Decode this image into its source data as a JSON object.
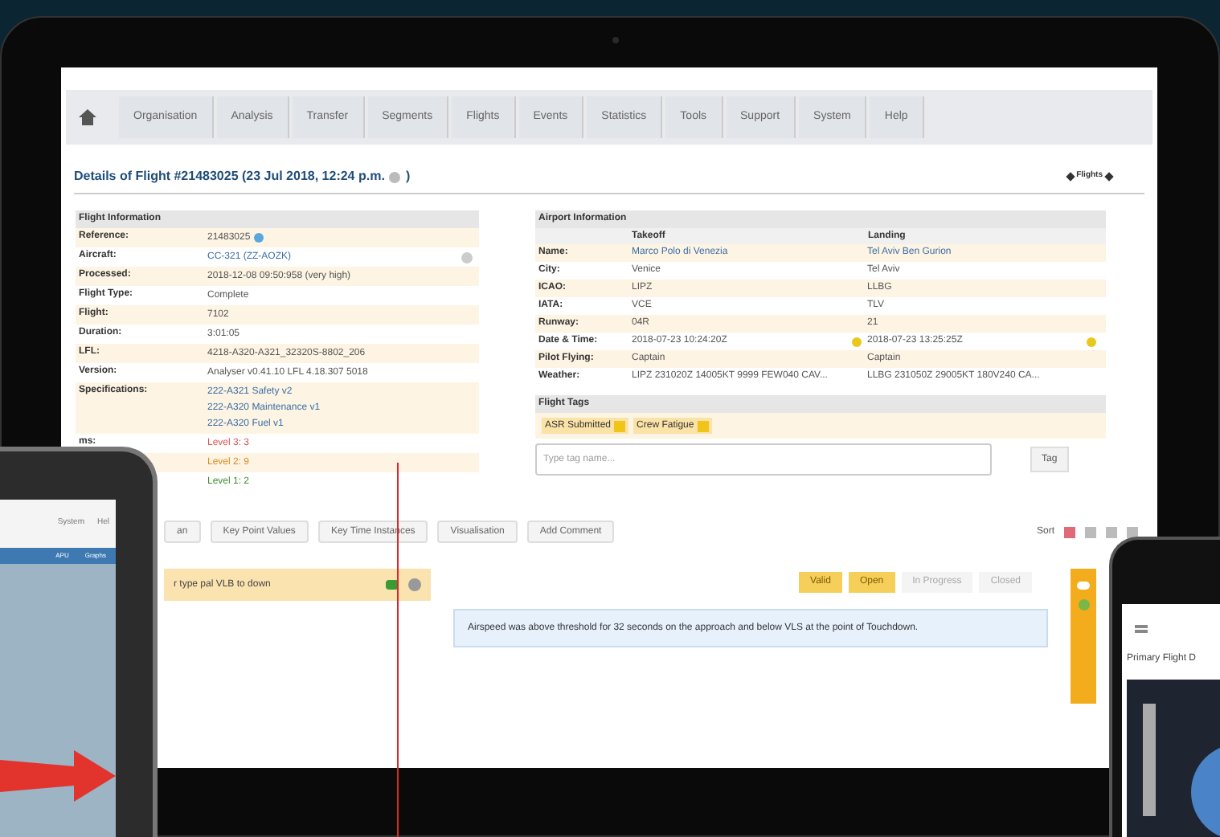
{
  "nav": {
    "tabs": [
      "Organisation",
      "Analysis",
      "Transfer",
      "Segments",
      "Flights",
      "Events",
      "Statistics",
      "Tools",
      "Support",
      "System",
      "Help"
    ]
  },
  "page_title": "Details of Flight #21483025 (23 Jul 2018, 12:24 p.m.",
  "page_title_end": ")",
  "flights_link": "Flights",
  "flight_info": {
    "title": "Flight Information",
    "rows": [
      {
        "label": "Reference:",
        "values": [
          {
            "kind": "plain",
            "text": "21483025"
          }
        ],
        "info": true
      },
      {
        "label": "Aircraft:",
        "values": [
          {
            "kind": "link",
            "text": "CC-321 (ZZ-AOZK)"
          }
        ],
        "action": true
      },
      {
        "label": "Processed:",
        "values": [
          {
            "kind": "plain",
            "text": "2018-12-08 09:50:958 (very high)"
          }
        ]
      },
      {
        "label": "Flight Type:",
        "values": [
          {
            "kind": "plain",
            "text": "Complete"
          }
        ]
      },
      {
        "label": "Flight:",
        "values": [
          {
            "kind": "plain",
            "text": "7102"
          }
        ]
      },
      {
        "label": "Duration:",
        "values": [
          {
            "kind": "plain",
            "text": "3:01:05"
          }
        ]
      },
      {
        "label": "LFL:",
        "values": [
          {
            "kind": "plain",
            "text": "4218-A320-A321_32320S-8802_206"
          }
        ]
      },
      {
        "label": "Version:",
        "values": [
          {
            "kind": "plain",
            "text": "Analyser v0.41.10 LFL 4.18.307 5018"
          }
        ]
      },
      {
        "label": "Specifications:",
        "values": [
          {
            "kind": "link",
            "text": "222-A321 Safety v2"
          },
          {
            "kind": "link",
            "text": "222-A320 Maintenance v1"
          },
          {
            "kind": "link",
            "text": "222-A320 Fuel v1"
          }
        ]
      },
      {
        "label": "ms:",
        "values": [
          {
            "kind": "level",
            "text": "Level 3: 3",
            "color": "#d9534f"
          }
        ]
      },
      {
        "values": [
          {
            "kind": "level",
            "text": "Level 2: 9",
            "color": "#e08a1e"
          }
        ]
      },
      {
        "values": [
          {
            "kind": "level",
            "text": "Level 1: 2",
            "color": "#3c8d2f"
          }
        ]
      }
    ]
  },
  "airport_info": {
    "title": "Airport Information",
    "columns": [
      "Takeoff",
      "Landing"
    ],
    "rows": [
      {
        "label": "Name:",
        "values": [
          "Marco Polo di Venezia",
          "Tel Aviv Ben Gurion"
        ],
        "kind": "link"
      },
      {
        "label": "City:",
        "values": [
          "Venice",
          "Tel Aviv"
        ],
        "kind": "plain"
      },
      {
        "label": "ICAO:",
        "values": [
          "LIPZ",
          "LLBG"
        ],
        "kind": "plain"
      },
      {
        "label": "IATA:",
        "values": [
          "VCE",
          "TLV"
        ],
        "kind": "plain"
      },
      {
        "label": "Runway:",
        "values": [
          "04R",
          "21"
        ],
        "kind": "plain"
      },
      {
        "label": "Date & Time:",
        "values": [
          "2018-07-23 10:24:20Z",
          "2018-07-23 13:25:25Z"
        ],
        "kind": "time"
      },
      {
        "label": "Pilot Flying:",
        "values": [
          "Captain",
          "Captain"
        ],
        "kind": "plain"
      },
      {
        "label": "Weather:",
        "values": [
          "LIPZ 231020Z 14005KT 9999 FEW040 CAV...",
          "LLBG 231050Z 29005KT 180V240 CA..."
        ],
        "kind": "plain"
      }
    ]
  },
  "flight_tags": {
    "title": "Flight Tags",
    "tags": [
      "ASR Submitted",
      "Crew Fatigue"
    ],
    "placeholder": "Type tag name...",
    "button": "Tag"
  },
  "toolbar": {
    "buttons": [
      "an",
      "Key Point Values",
      "Key Time Instances",
      "Visualisation",
      "Add Comment"
    ],
    "sort_label": "Sort"
  },
  "event": {
    "text": "r type pal VLB to down",
    "statuses": [
      {
        "label": "Valid",
        "selected": true
      },
      {
        "label": "Open",
        "selected": true
      },
      {
        "label": "In Progress",
        "selected": false
      },
      {
        "label": "Closed",
        "selected": false
      }
    ],
    "comment": "Airspeed was above threshold for 32 seconds on the approach and below VLS at the point of Touchdown."
  },
  "tablet": {
    "nav": [
      "System",
      "Hel"
    ],
    "bar": [
      "APU",
      "Graphs"
    ]
  },
  "phone": {
    "title": "Primary Flight D"
  }
}
